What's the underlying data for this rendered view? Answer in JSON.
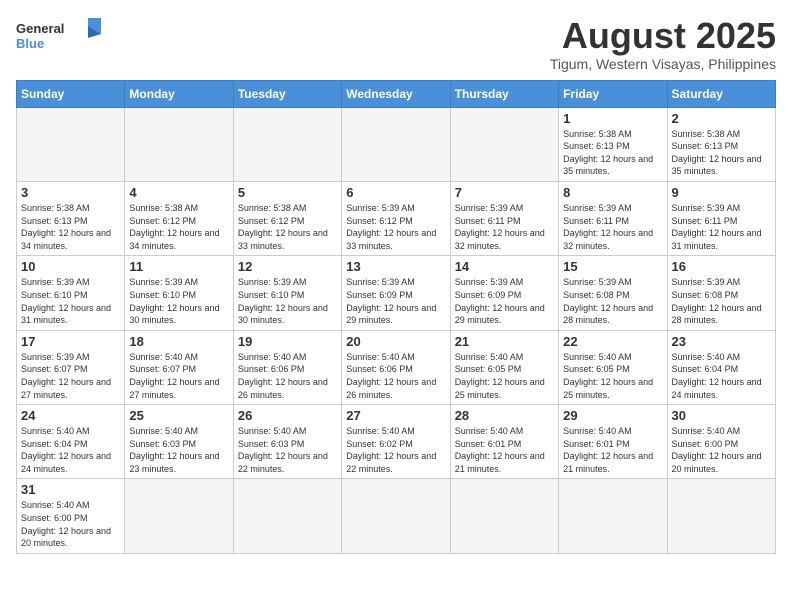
{
  "logo": {
    "general": "General",
    "blue": "Blue"
  },
  "title": "August 2025",
  "subtitle": "Tigum, Western Visayas, Philippines",
  "days_of_week": [
    "Sunday",
    "Monday",
    "Tuesday",
    "Wednesday",
    "Thursday",
    "Friday",
    "Saturday"
  ],
  "weeks": [
    [
      {
        "day": "",
        "empty": true
      },
      {
        "day": "",
        "empty": true
      },
      {
        "day": "",
        "empty": true
      },
      {
        "day": "",
        "empty": true
      },
      {
        "day": "",
        "empty": true
      },
      {
        "day": "1",
        "sunrise": "5:38 AM",
        "sunset": "6:13 PM",
        "daylight": "12 hours and 35 minutes."
      },
      {
        "day": "2",
        "sunrise": "5:38 AM",
        "sunset": "6:13 PM",
        "daylight": "12 hours and 35 minutes."
      }
    ],
    [
      {
        "day": "3",
        "sunrise": "5:38 AM",
        "sunset": "6:13 PM",
        "daylight": "12 hours and 34 minutes."
      },
      {
        "day": "4",
        "sunrise": "5:38 AM",
        "sunset": "6:12 PM",
        "daylight": "12 hours and 34 minutes."
      },
      {
        "day": "5",
        "sunrise": "5:38 AM",
        "sunset": "6:12 PM",
        "daylight": "12 hours and 33 minutes."
      },
      {
        "day": "6",
        "sunrise": "5:39 AM",
        "sunset": "6:12 PM",
        "daylight": "12 hours and 33 minutes."
      },
      {
        "day": "7",
        "sunrise": "5:39 AM",
        "sunset": "6:11 PM",
        "daylight": "12 hours and 32 minutes."
      },
      {
        "day": "8",
        "sunrise": "5:39 AM",
        "sunset": "6:11 PM",
        "daylight": "12 hours and 32 minutes."
      },
      {
        "day": "9",
        "sunrise": "5:39 AM",
        "sunset": "6:11 PM",
        "daylight": "12 hours and 31 minutes."
      }
    ],
    [
      {
        "day": "10",
        "sunrise": "5:39 AM",
        "sunset": "6:10 PM",
        "daylight": "12 hours and 31 minutes."
      },
      {
        "day": "11",
        "sunrise": "5:39 AM",
        "sunset": "6:10 PM",
        "daylight": "12 hours and 30 minutes."
      },
      {
        "day": "12",
        "sunrise": "5:39 AM",
        "sunset": "6:10 PM",
        "daylight": "12 hours and 30 minutes."
      },
      {
        "day": "13",
        "sunrise": "5:39 AM",
        "sunset": "6:09 PM",
        "daylight": "12 hours and 29 minutes."
      },
      {
        "day": "14",
        "sunrise": "5:39 AM",
        "sunset": "6:09 PM",
        "daylight": "12 hours and 29 minutes."
      },
      {
        "day": "15",
        "sunrise": "5:39 AM",
        "sunset": "6:08 PM",
        "daylight": "12 hours and 28 minutes."
      },
      {
        "day": "16",
        "sunrise": "5:39 AM",
        "sunset": "6:08 PM",
        "daylight": "12 hours and 28 minutes."
      }
    ],
    [
      {
        "day": "17",
        "sunrise": "5:39 AM",
        "sunset": "6:07 PM",
        "daylight": "12 hours and 27 minutes."
      },
      {
        "day": "18",
        "sunrise": "5:40 AM",
        "sunset": "6:07 PM",
        "daylight": "12 hours and 27 minutes."
      },
      {
        "day": "19",
        "sunrise": "5:40 AM",
        "sunset": "6:06 PM",
        "daylight": "12 hours and 26 minutes."
      },
      {
        "day": "20",
        "sunrise": "5:40 AM",
        "sunset": "6:06 PM",
        "daylight": "12 hours and 26 minutes."
      },
      {
        "day": "21",
        "sunrise": "5:40 AM",
        "sunset": "6:05 PM",
        "daylight": "12 hours and 25 minutes."
      },
      {
        "day": "22",
        "sunrise": "5:40 AM",
        "sunset": "6:05 PM",
        "daylight": "12 hours and 25 minutes."
      },
      {
        "day": "23",
        "sunrise": "5:40 AM",
        "sunset": "6:04 PM",
        "daylight": "12 hours and 24 minutes."
      }
    ],
    [
      {
        "day": "24",
        "sunrise": "5:40 AM",
        "sunset": "6:04 PM",
        "daylight": "12 hours and 24 minutes."
      },
      {
        "day": "25",
        "sunrise": "5:40 AM",
        "sunset": "6:03 PM",
        "daylight": "12 hours and 23 minutes."
      },
      {
        "day": "26",
        "sunrise": "5:40 AM",
        "sunset": "6:03 PM",
        "daylight": "12 hours and 22 minutes."
      },
      {
        "day": "27",
        "sunrise": "5:40 AM",
        "sunset": "6:02 PM",
        "daylight": "12 hours and 22 minutes."
      },
      {
        "day": "28",
        "sunrise": "5:40 AM",
        "sunset": "6:01 PM",
        "daylight": "12 hours and 21 minutes."
      },
      {
        "day": "29",
        "sunrise": "5:40 AM",
        "sunset": "6:01 PM",
        "daylight": "12 hours and 21 minutes."
      },
      {
        "day": "30",
        "sunrise": "5:40 AM",
        "sunset": "6:00 PM",
        "daylight": "12 hours and 20 minutes."
      }
    ],
    [
      {
        "day": "31",
        "sunrise": "5:40 AM",
        "sunset": "6:00 PM",
        "daylight": "12 hours and 20 minutes."
      },
      {
        "day": "",
        "empty": true
      },
      {
        "day": "",
        "empty": true
      },
      {
        "day": "",
        "empty": true
      },
      {
        "day": "",
        "empty": true
      },
      {
        "day": "",
        "empty": true
      },
      {
        "day": "",
        "empty": true
      }
    ]
  ]
}
